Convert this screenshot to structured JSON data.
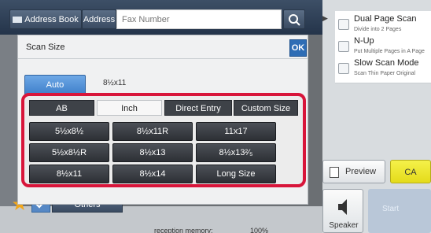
{
  "header": {
    "address_book_label": "Address Book",
    "address_label": "Address",
    "fax_placeholder": "Fax Number"
  },
  "options": [
    {
      "title": "Dual Page Scan",
      "subtitle": "Divide into 2 Pages"
    },
    {
      "title": "N-Up",
      "subtitle": "Put Multiple Pages in A Page"
    },
    {
      "title": "Slow Scan Mode",
      "subtitle": "Scan Thin Paper Original"
    }
  ],
  "dialog": {
    "title": "Scan Size",
    "ok_label": "OK",
    "auto_label": "Auto",
    "auto_value": "8½x11",
    "tabs": [
      "AB",
      "Inch",
      "Direct Entry",
      "Custom Size"
    ],
    "active_tab": "Inch",
    "sizes": [
      "5½x8½",
      "8½x11R",
      "11x17",
      "5½x8½R",
      "8½x13",
      "8½x13²⁄₅",
      "8½x11",
      "8½x14",
      "Long Size"
    ]
  },
  "actions": {
    "preview_label": "Preview",
    "ca_label": "CA",
    "speaker_label": "Speaker",
    "start_label": "Start"
  },
  "footer": {
    "others_label": "Others",
    "memory_label": "reception memory:",
    "memory_value": "100%"
  },
  "colors": {
    "highlight": "#d8153a",
    "accent_blue": "#3e7fca",
    "ca_yellow": "#e4db1a"
  }
}
